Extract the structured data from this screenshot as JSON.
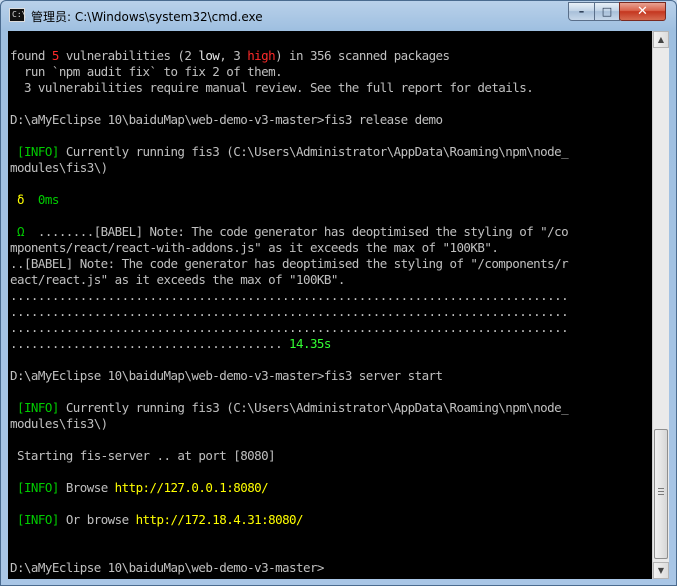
{
  "window": {
    "title": "管理员: C:\\Windows\\system32\\cmd.exe",
    "icon_text": "C:\\",
    "controls": {
      "minimize": "–",
      "maximize": "□",
      "close": "✕"
    }
  },
  "colors": {
    "red": "#ff2a2a",
    "green": "#00cc00",
    "yellow": "#ffff00",
    "text": "#c0c0c0",
    "background": "#000000"
  },
  "console": {
    "lines": [
      [
        {
          "t": "found "
        },
        {
          "t": "5",
          "c": "red"
        },
        {
          "t": " vulnerabilities (2 "
        },
        {
          "t": "low",
          "c": "white"
        },
        {
          "t": ", 3 "
        },
        {
          "t": "high",
          "c": "red"
        },
        {
          "t": ") in 356 scanned packages"
        }
      ],
      [
        {
          "t": "  run `npm audit fix` to fix 2 of them."
        }
      ],
      [
        {
          "t": "  3 vulnerabilities require manual review. See the full report for details."
        }
      ],
      [
        {
          "t": ""
        }
      ],
      [
        {
          "t": "D:\\aMyEclipse 10\\baiduMap\\web-demo-v3-master>fis3 release demo"
        }
      ],
      [
        {
          "t": ""
        }
      ],
      [
        {
          "t": " [INFO]",
          "c": "green"
        },
        {
          "t": " Currently running fis3 (C:\\Users\\Administrator\\AppData\\Roaming\\npm\\node_"
        }
      ],
      [
        {
          "t": "modules\\fis3\\)"
        }
      ],
      [
        {
          "t": ""
        }
      ],
      [
        {
          "t": " δ  ",
          "c": "yellow"
        },
        {
          "t": "0ms",
          "c": "green"
        }
      ],
      [
        {
          "t": ""
        }
      ],
      [
        {
          "t": " Ω",
          "c": "green"
        },
        {
          "t": "  ........[BABEL] Note: The code generator has deoptimised the styling of \"/co"
        }
      ],
      [
        {
          "t": "mponents/react/react-with-addons.js\" as it exceeds the max of \"100KB\"."
        }
      ],
      [
        {
          "t": "..[BABEL] Note: The code generator has deoptimised the styling of \"/components/r"
        }
      ],
      [
        {
          "t": "eact/react.js\" as it exceeds the max of \"100KB\"."
        }
      ],
      [
        {
          "t": "................................................................................"
        }
      ],
      [
        {
          "t": "................................................................................"
        }
      ],
      [
        {
          "t": "................................................................................"
        }
      ],
      [
        {
          "t": "....................................... "
        },
        {
          "t": "14.35s",
          "c": "bright-green"
        }
      ],
      [
        {
          "t": ""
        }
      ],
      [
        {
          "t": "D:\\aMyEclipse 10\\baiduMap\\web-demo-v3-master>fis3 server start"
        }
      ],
      [
        {
          "t": ""
        }
      ],
      [
        {
          "t": " [INFO]",
          "c": "green"
        },
        {
          "t": " Currently running fis3 (C:\\Users\\Administrator\\AppData\\Roaming\\npm\\node_"
        }
      ],
      [
        {
          "t": "modules\\fis3\\)"
        }
      ],
      [
        {
          "t": ""
        }
      ],
      [
        {
          "t": " Starting fis-server .. at port [8080]"
        }
      ],
      [
        {
          "t": ""
        }
      ],
      [
        {
          "t": " [INFO]",
          "c": "green"
        },
        {
          "t": " Browse "
        },
        {
          "t": "http://127.0.0.1:8080/",
          "c": "yellow"
        }
      ],
      [
        {
          "t": ""
        }
      ],
      [
        {
          "t": " [INFO]",
          "c": "green"
        },
        {
          "t": " Or browse "
        },
        {
          "t": "http://172.18.4.31:8080/",
          "c": "yellow"
        }
      ],
      [
        {
          "t": ""
        }
      ],
      [
        {
          "t": ""
        }
      ],
      [
        {
          "t": "D:\\aMyEclipse 10\\baiduMap\\web-demo-v3-master>"
        }
      ]
    ]
  },
  "scrollbar": {
    "up_glyph": "▲",
    "down_glyph": "▼",
    "position_fraction": 0.96
  }
}
